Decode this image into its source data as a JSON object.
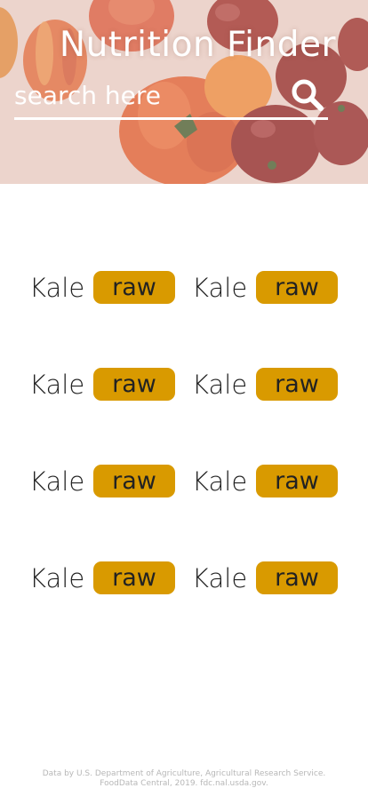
{
  "header": {
    "title": "Nutrition Finder",
    "search_placeholder": "search here",
    "search_value": ""
  },
  "foods": [
    {
      "name": "Kale",
      "tag": "raw"
    },
    {
      "name": "Kale",
      "tag": "raw"
    },
    {
      "name": "Kale",
      "tag": "raw"
    },
    {
      "name": "Kale",
      "tag": "raw"
    },
    {
      "name": "Kale",
      "tag": "raw"
    },
    {
      "name": "Kale",
      "tag": "raw"
    },
    {
      "name": "Kale",
      "tag": "raw"
    },
    {
      "name": "Kale",
      "tag": "raw"
    }
  ],
  "footer": {
    "line1": "Data by U.S. Department of Agriculture, Agricultural Research Service.",
    "line2": "FoodData Central, 2019. fdc.nal.usda.gov."
  },
  "colors": {
    "tag_background": "#d99a00",
    "hero_tint": "#e7cdc3",
    "text_dark": "#222222"
  },
  "icons": {
    "search": "search-icon"
  }
}
